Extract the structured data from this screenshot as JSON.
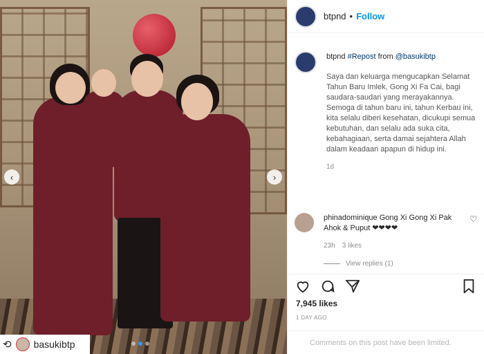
{
  "photo": {
    "prev_icon": "chevron-left-icon",
    "next_icon": "chevron-right-icon",
    "repost_icon": "repost-icon",
    "repost_user": "basukibtp",
    "carousel_count": 3,
    "carousel_active": 1
  },
  "header": {
    "username": "btpnd",
    "separator": "•",
    "follow_label": "Follow"
  },
  "caption": {
    "username": "btpnd",
    "hashtag": "#Repost",
    "from_text": " from ",
    "mention": "@basukibtp",
    "body": "Saya dan keluarga mengucapkan Selamat Tahun Baru Imlek, Gong Xi Fa Cai, bagi saudara-saudari yang merayakannya. Semoga di tahun baru ini, tahun Kerbau ini, kita selalu diberi kesehatan, dicukupi semua kebutuhan, dan selalu ada suka cita, kebahagiaan, serta damai sejahtera Allah dalam keadaan apapun di hidup ini.",
    "time": "1d"
  },
  "comment": {
    "username": "phinadominique",
    "text": " Gong Xi Gong Xi Pak Ahok & Puput ❤❤❤❤",
    "time": "23h",
    "likes": "3 likes",
    "view_replies": "View replies (1)"
  },
  "actions": {
    "like_icon": "heart-icon",
    "comment_icon": "comment-icon",
    "share_icon": "share-icon",
    "save_icon": "bookmark-icon"
  },
  "likes_count": "7,945 likes",
  "posted": "1 DAY AGO",
  "comments_limited": "Comments on this post have been limited."
}
